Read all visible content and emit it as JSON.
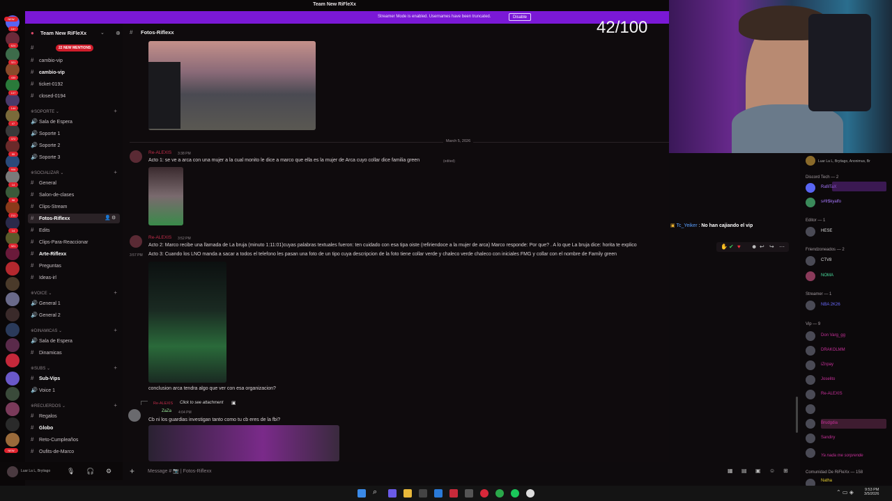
{
  "window": {
    "title": "Team New RiFleXx"
  },
  "banner": {
    "text": "Streamer Mode is enabled. Usernames have been truncated.",
    "button": "Disable"
  },
  "counter": "42/100",
  "server_badges": [
    "NEW",
    "16+",
    "624",
    "321",
    "430",
    "107",
    "144",
    "47",
    "372",
    "55",
    "906",
    "14",
    "98",
    "211",
    "14",
    "321",
    "NEW"
  ],
  "server": {
    "name": "Team New RiFleXx",
    "mentions": "22 NEW MENTIONS"
  },
  "channels": {
    "top": [
      {
        "name": "cambio-vip"
      },
      {
        "name": "cambio-vip"
      },
      {
        "name": "ticket-0192"
      },
      {
        "name": "closed-0194"
      }
    ],
    "categories": [
      {
        "name": "SOPORTE",
        "items": [
          "Sala de Espera",
          "Soporte 1",
          "Soporte 2",
          "Soporte 3"
        ]
      },
      {
        "name": "SOCIALIZAR",
        "items": [
          "General",
          "Salon-de-clases",
          "Clips-Stream",
          "Fotos-Riflexx",
          "Edits",
          "Clips-Para-Reaccionar",
          "Arte-Riflexx",
          "Preguntas",
          "Ideas-irl"
        ]
      },
      {
        "name": "VOICE",
        "items": [
          "General 1",
          "General 2"
        ]
      },
      {
        "name": "DINAMICAS",
        "items": [
          "Sala de Espera",
          "Dinamicas"
        ]
      },
      {
        "name": "SUBS",
        "items": [
          "Sub-Vips",
          "Voice 1"
        ]
      },
      {
        "name": "RECUERDOS",
        "items": [
          "Regalos",
          "Globo",
          "Reto-Cumpleaños",
          "Oufits-de-Marco"
        ]
      }
    ],
    "user": {
      "name": "Luar La L, Brytiago"
    }
  },
  "chat": {
    "channel": "Fotos-Riflexx",
    "date_divider": "March 5, 2026",
    "messages": [
      {
        "user": "Re-ALEXIS",
        "time": "3:38 PM",
        "text": "Acto 1: se ve a arca con  una  mujer a la cual monito le dice a marco que ella es la mujer de Arca cuyo collar dice familia green",
        "edited": "(edited)"
      },
      {
        "user": "Re-ALEXIS",
        "time": "3:52 PM",
        "side_time": "3:57 PM",
        "text": "Acto 2: Marco recibe una llamada de La bruja (minuto 1:11:01)cuyas palabras textuales fueron: ten cuidado con esa tipa oiste (refiriendoce a la mujer de arca) Marco responde: Por que? . A lo que La bruja dice: horita te explico",
        "text2": "Acto 3: Cuando los  LNO manda a sacar a todos el telefono les pasan una foto de un tipo cuya descripcion de la foto tiene collar verde y chaleco verde chaleco con iniciales FMG y collar con el nombre de Family green",
        "text3": "conclusion arca tendra algo que ver con esa organizacion?"
      },
      {
        "reply_user": "Re-ALEXIS",
        "reply_text": "Click to see attachment",
        "user": "ZaZa",
        "time": "4:04 PM",
        "text": "Cb ni los guardias investigan tanto como tu cb eres de la fbi?"
      }
    ],
    "input_placeholder": "Message # 📷 | Fotos-Riflexx"
  },
  "overlay_chat": {
    "user": "Tc_Yeiker",
    "text": "No han cajiando el vip"
  },
  "members": {
    "top_text": "Luar La L, Brytiago, Anonimus, Br",
    "groups": [
      {
        "label": "Discord Tech — 2",
        "items": [
          "RafilTaX",
          "s#fr$kyalfo"
        ]
      },
      {
        "label": "Editor — 1",
        "items": [
          "HESE"
        ]
      },
      {
        "label": "Friendzoneados — 2",
        "items": [
          "CTV8",
          "NOMA"
        ]
      },
      {
        "label": "Streamer — 1",
        "items": [
          "NBA 2K26"
        ]
      },
      {
        "label": "Vip — 9",
        "items": [
          "Don Varg_gg",
          "DRAKOLMM",
          "iZnpay",
          "Joselito",
          "Re-ALEXIS",
          "",
          "Brudgdia",
          "Sandiry",
          "Ya nada me sorprende"
        ]
      },
      {
        "label": "Comunidad De RiFleXx — 158",
        "items": [
          "Natha"
        ]
      }
    ]
  },
  "clock": {
    "time": "9:53 PM",
    "date": "3/5/2026"
  },
  "colors": {
    "banner": "#7a18d6",
    "username": "#c32d4a",
    "accent": "#5865f2"
  }
}
